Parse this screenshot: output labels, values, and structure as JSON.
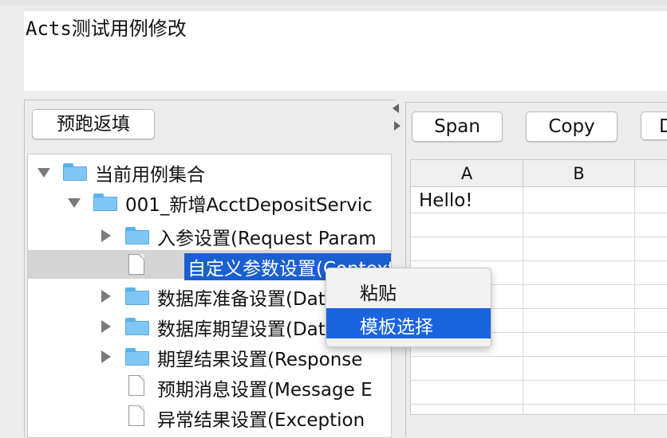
{
  "title": "Acts测试用例修改",
  "left_toolbar": {
    "prefill_button": "预跑返填"
  },
  "tree": {
    "root": "当前用例集合",
    "case": "001_新增AcctDepositServic",
    "items": [
      {
        "label": "入参设置(Request Param",
        "type": "folder",
        "expandable": true
      },
      {
        "label": "自定义参数设置(Context",
        "type": "file",
        "expandable": false,
        "selected": true
      },
      {
        "label": "数据库准备设置(Data",
        "type": "folder",
        "expandable": true
      },
      {
        "label": "数据库期望设置(Data",
        "type": "folder",
        "expandable": true
      },
      {
        "label": "期望结果设置(Response",
        "type": "folder",
        "expandable": true
      },
      {
        "label": "预期消息设置(Message E",
        "type": "file",
        "expandable": false
      },
      {
        "label": "异常结果设置(Exception",
        "type": "file",
        "expandable": false
      }
    ]
  },
  "right_toolbar": {
    "span_button": "Span",
    "copy_button": "Copy",
    "third_button": "D"
  },
  "sheet": {
    "columns": [
      "A",
      "B",
      ""
    ],
    "cell_a1": "Hello!"
  },
  "context_menu": {
    "items": [
      "粘贴",
      "模板选择"
    ],
    "active_index": 1
  },
  "colors": {
    "selection": "#1a5fd0",
    "menu_highlight": "#1a64e0",
    "folder": "#7fc6f5"
  }
}
